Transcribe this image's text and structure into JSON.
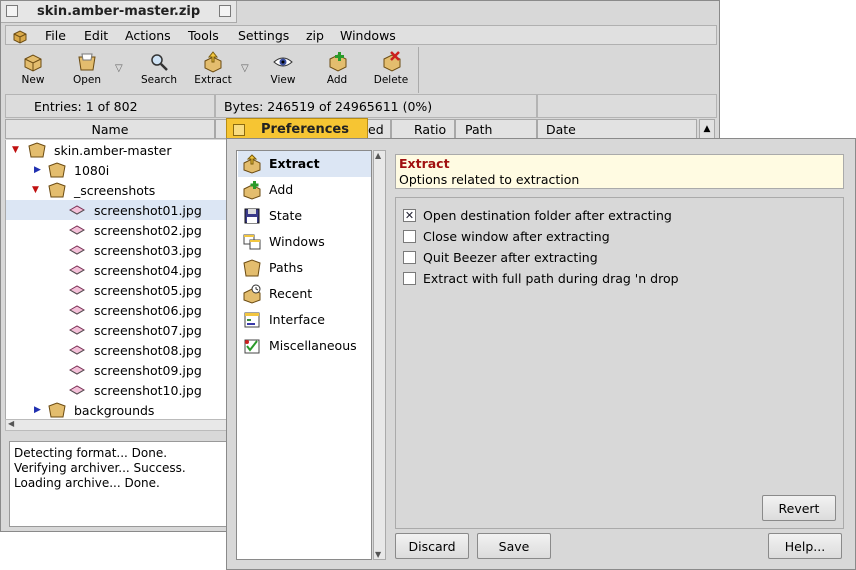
{
  "main_window": {
    "title": "skin.amber-master.zip",
    "menu": [
      "File",
      "Edit",
      "Actions",
      "Tools",
      "Settings",
      "zip",
      "Windows"
    ],
    "toolbar": {
      "new_label": "New",
      "open_label": "Open",
      "search_label": "Search",
      "extract_label": "Extract",
      "view_label": "View",
      "add_label": "Add",
      "delete_label": "Delete"
    },
    "status": {
      "entries": "Entries: 1 of 802",
      "bytes": "Bytes: 246519 of 24965611 (0%)"
    },
    "columns": [
      "Name",
      "ed",
      "Ratio",
      "Path",
      "Date"
    ],
    "tree": [
      {
        "label": "skin.amber-master",
        "kind": "folder",
        "expanded": true
      },
      {
        "label": "1080i",
        "kind": "folder",
        "expanded": false
      },
      {
        "label": "_screenshots",
        "kind": "folder",
        "expanded": true
      },
      {
        "label": "screenshot01.jpg",
        "kind": "file",
        "selected": true
      },
      {
        "label": "screenshot02.jpg",
        "kind": "file"
      },
      {
        "label": "screenshot03.jpg",
        "kind": "file"
      },
      {
        "label": "screenshot04.jpg",
        "kind": "file"
      },
      {
        "label": "screenshot05.jpg",
        "kind": "file"
      },
      {
        "label": "screenshot06.jpg",
        "kind": "file"
      },
      {
        "label": "screenshot07.jpg",
        "kind": "file"
      },
      {
        "label": "screenshot08.jpg",
        "kind": "file"
      },
      {
        "label": "screenshot09.jpg",
        "kind": "file"
      },
      {
        "label": "screenshot10.jpg",
        "kind": "file"
      },
      {
        "label": "backgrounds",
        "kind": "folder",
        "expanded": false
      }
    ],
    "log": [
      "Detecting format... Done.",
      "Verifying archiver... Success.",
      "Loading archive... Done."
    ]
  },
  "preferences": {
    "title": "Preferences",
    "categories": [
      "Extract",
      "Add",
      "State",
      "Windows",
      "Paths",
      "Recent",
      "Interface",
      "Miscellaneous"
    ],
    "active_category": "Extract",
    "header": "Extract",
    "subheader": "Options related to extraction",
    "options": [
      {
        "label": "Open destination folder after extracting",
        "checked": true
      },
      {
        "label": "Close window after extracting",
        "checked": false
      },
      {
        "label": "Quit Beezer after extracting",
        "checked": false
      },
      {
        "label": "Extract with full path during drag 'n drop",
        "checked": false
      }
    ],
    "buttons": {
      "revert": "Revert",
      "discard": "Discard",
      "save": "Save",
      "help": "Help..."
    }
  },
  "colors": {
    "tab_yellow": "#f6c533",
    "selection": "#dce6f4",
    "info_bg": "#fffbe2",
    "info_title": "#a01010"
  }
}
